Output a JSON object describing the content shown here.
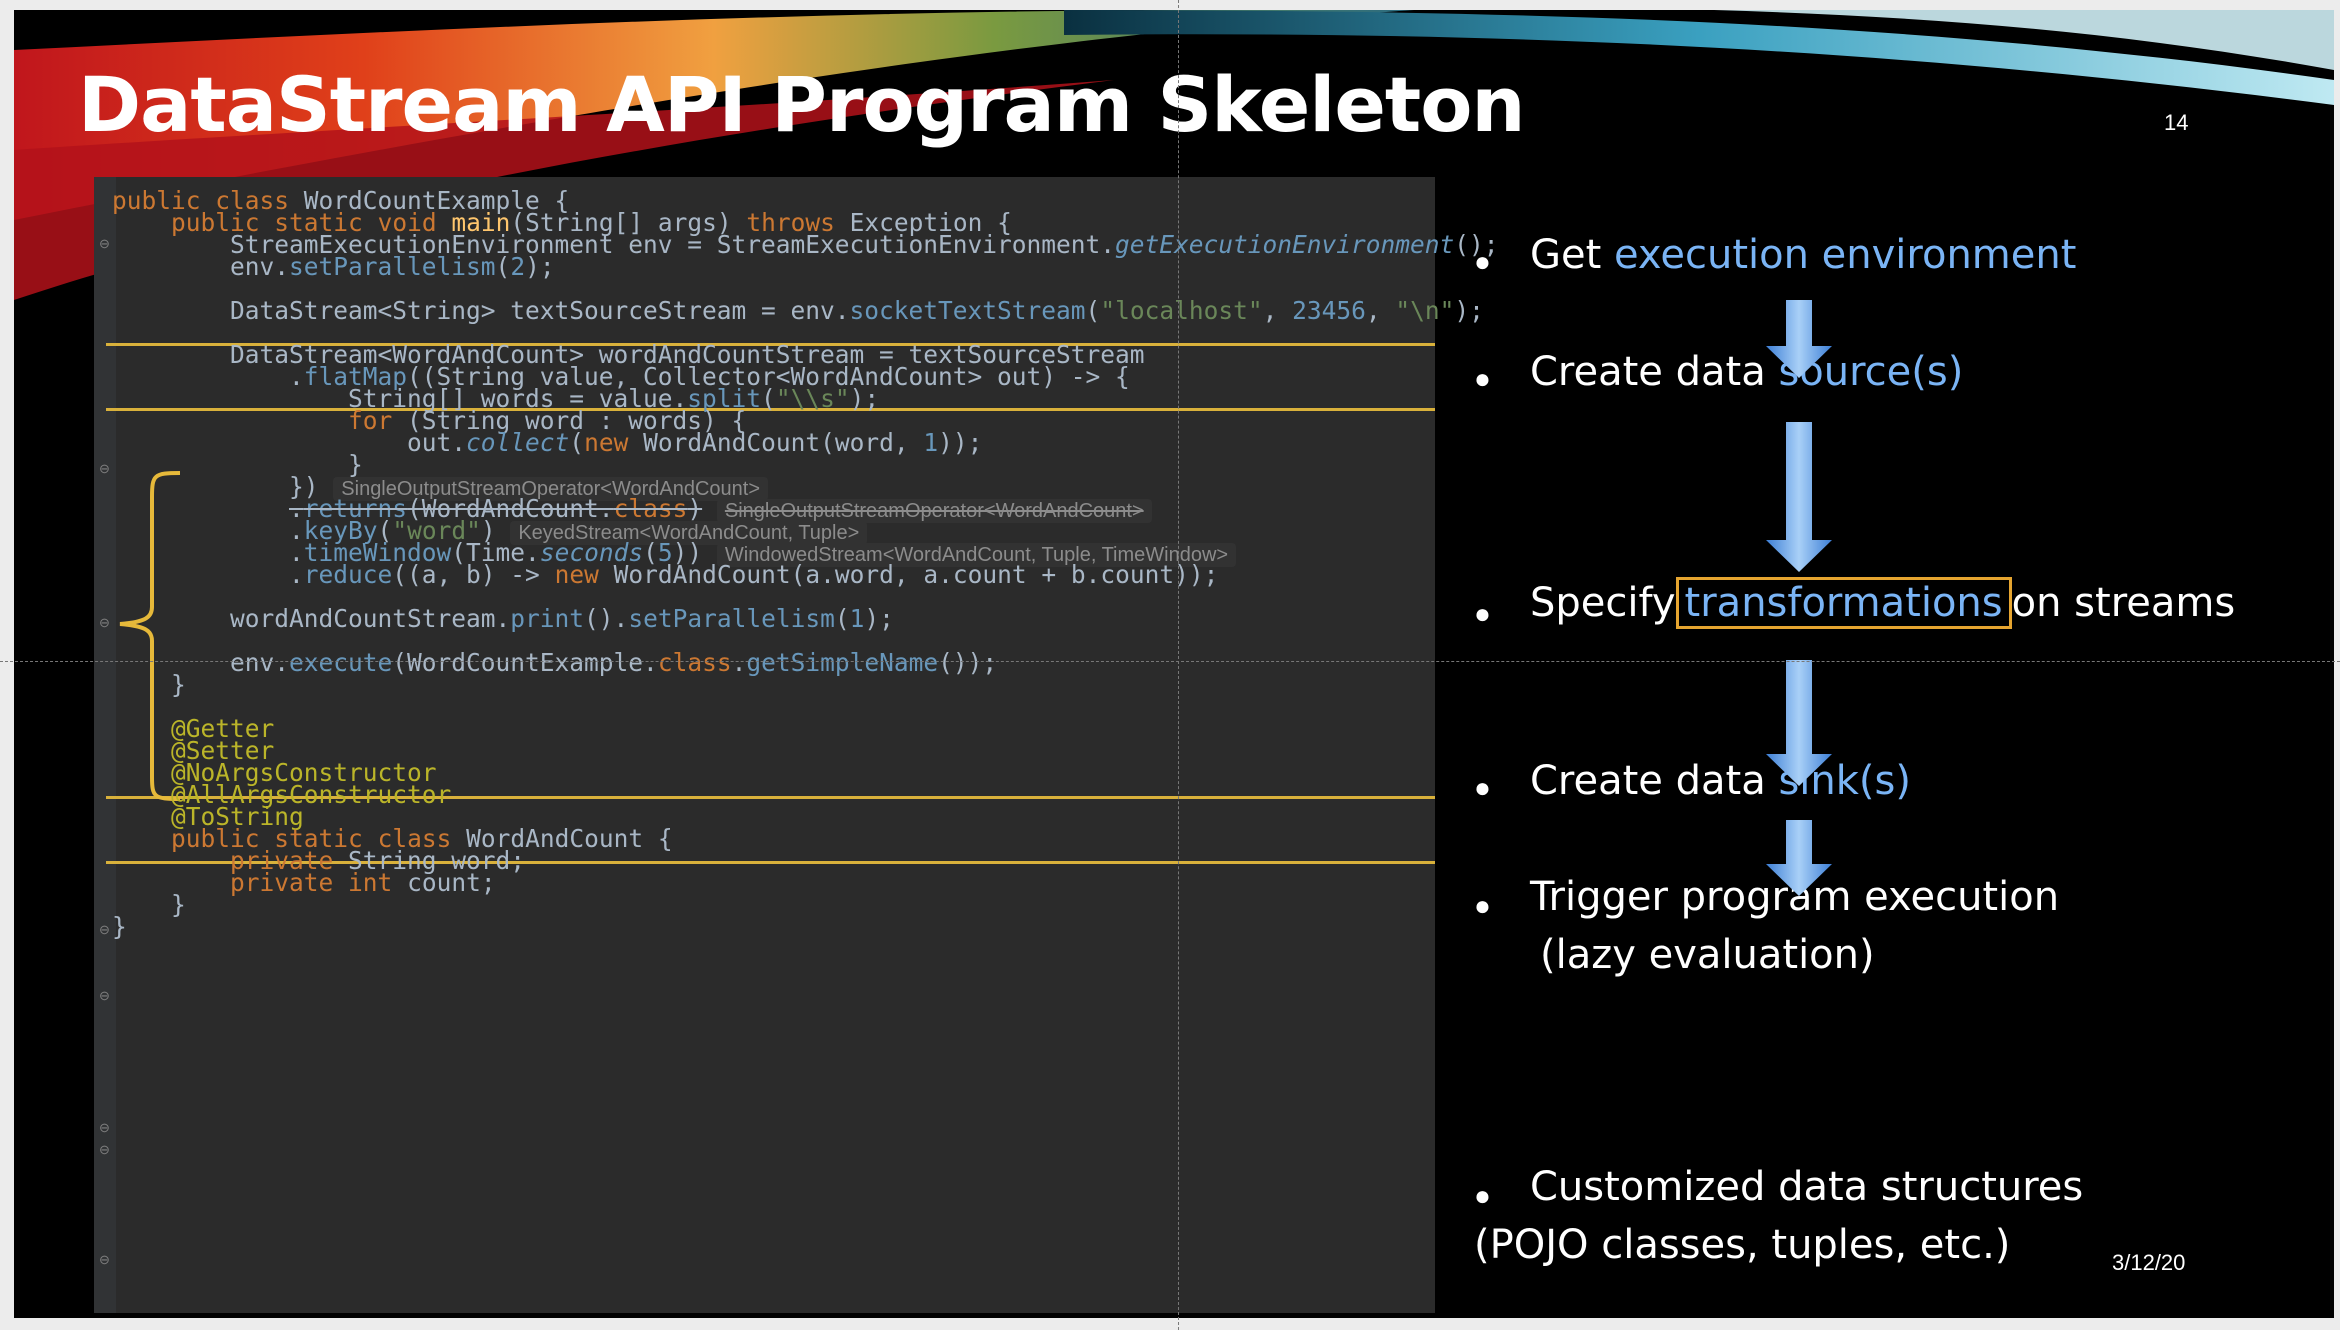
{
  "slide": {
    "title": "DataStream API Program Skeleton",
    "number": "14",
    "date": "3/12/20"
  },
  "code": {
    "lines": [
      "public class WordCountExample {",
      "  public static void main(String[] args) throws Exception {",
      "    StreamExecutionEnvironment env = StreamExecutionEnvironment.getExecutionEnvironment();",
      "    env.setParallelism(2);",
      "    DataStream<String> textSourceStream = env.socketTextStream(\"localhost\", 23456, \"\\n\");",
      "    DataStream<WordAndCount> wordAndCountStream = textSourceStream",
      "      .flatMap((String value, Collector<WordAndCount> out) -> {",
      "        String[] words = value.split(\"\\\\s\");",
      "        for (String word : words) {",
      "          out.collect(new WordAndCount(word, 1));",
      "        }",
      "      })",
      "      .returns(WordAndCount.class)",
      "      .keyBy(\"word\")",
      "      .timeWindow(Time.seconds(5))",
      "      .reduce((a, b) -> new WordAndCount(a.word, a.count + b.count));",
      "    wordAndCountStream.print().setParallelism(1);",
      "    env.execute(WordCountExample.class.getSimpleName());",
      "  }",
      "  @Getter",
      "  @Setter",
      "  @NoArgsConstructor",
      "  @AllArgsConstructor",
      "  @ToString",
      "  public static class WordAndCount {",
      "    private String word;",
      "    private int count;",
      "  }",
      "}"
    ],
    "hints": {
      "flatmap_result": "SingleOutputStreamOperator<WordAndCount>",
      "returns_result": "SingleOutputStreamOperator<WordAndCount>",
      "keyby_result": "KeyedStream<WordAndCount, Tuple>",
      "timewindow_result": "WindowedStream<WordAndCount, Tuple, TimeWindow>"
    }
  },
  "bullets": {
    "env": {
      "prefix": "Get ",
      "highlight": "execution environment"
    },
    "source": {
      "prefix": "Create data ",
      "highlight": "source(s)"
    },
    "transform": {
      "prefix": "Specify",
      "highlight": "transformations",
      "suffix": "on streams"
    },
    "sink": {
      "prefix": "Create data ",
      "highlight": "sink(s)"
    },
    "trigger": {
      "line1": "Trigger program execution",
      "line2": "(lazy evaluation)"
    },
    "pojo": {
      "line1": "Customized data structures",
      "line2": "(POJO classes, tuples, etc.)"
    }
  },
  "colors": {
    "highlight": "#7ab4f5",
    "separator": "#d9b13b",
    "box": "#e6a530"
  }
}
